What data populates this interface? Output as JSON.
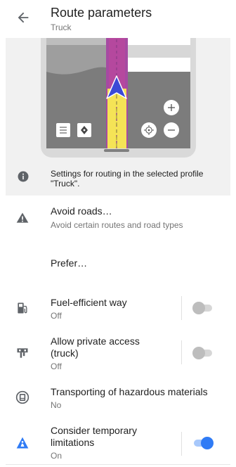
{
  "header": {
    "title": "Route parameters",
    "subtitle": "Truck",
    "back_icon": "arrow-left-icon"
  },
  "info": {
    "icon": "info-icon",
    "text": "Settings for routing in the selected profile \"Truck\"."
  },
  "rows": {
    "avoid_roads": {
      "title": "Avoid roads…",
      "subtitle": "Avoid certain routes and road types",
      "icon": "warning-icon"
    },
    "prefer": {
      "title": "Prefer…"
    },
    "fuel": {
      "title": "Fuel-efficient way",
      "value": "Off",
      "enabled": false,
      "icon": "fuel-pump-icon"
    },
    "private_access": {
      "title": "Allow private access (truck)",
      "value": "Off",
      "enabled": false,
      "icon": "barrier-icon"
    },
    "hazmat": {
      "title": "Transporting of hazardous materials",
      "value": "No",
      "icon": "hazmat-icon"
    },
    "temp_limits": {
      "title": "Consider temporary limitations",
      "value": "On",
      "enabled": true,
      "icon": "road-work-icon"
    }
  },
  "illustration": {
    "map_buttons": [
      "layers-icon",
      "compass-icon",
      "locate-icon",
      "zoom-in-icon",
      "zoom-out-icon"
    ],
    "route_color": "#f5e356",
    "route_border_color": "#a64aa2",
    "nav_arrow_color": "#3b49d6"
  },
  "colors": {
    "accent": "#2f7bf5",
    "panel_background": "#f1f1f1"
  }
}
